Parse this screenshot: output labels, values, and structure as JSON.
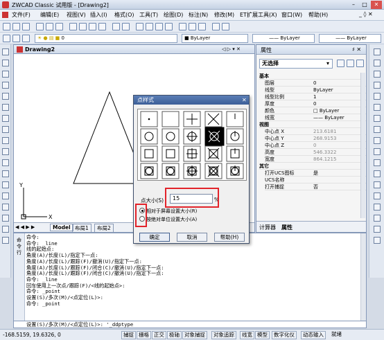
{
  "window": {
    "title": "ZWCAD Classic 试用版 - [Drawing2]",
    "min": "–",
    "max": "□",
    "close": "✕"
  },
  "menu": [
    "文件(F)",
    "编辑(E)",
    "视图(V)",
    "插入(I)",
    "格式(O)",
    "工具(T)",
    "绘图(D)",
    "标注(N)",
    "修改(M)",
    "ET扩展工具(X)",
    "窗口(W)",
    "帮助(H)"
  ],
  "mdi_controls": "_ ◊ ✕",
  "toolbar3": {
    "layer_value": "0",
    "color": "ByLayer",
    "linetype": "ByLayer",
    "lineweight": "ByLayer"
  },
  "drawing": {
    "tab_title": "Drawing2",
    "tab_controls": "◁ ▷ ▾ ✕",
    "layout_tabs": [
      "Model",
      "布局1",
      "布局2"
    ],
    "nav_arrows": "◀ ◀ ▶ ▶",
    "axis_y": "Y",
    "axis_x": "X"
  },
  "properties": {
    "title": "属性",
    "pin": "♯ ✕",
    "selection": "无选择",
    "sections": [
      {
        "name": "基本",
        "rows": [
          [
            "图层",
            "0"
          ],
          [
            "线型",
            "ByLayer"
          ],
          [
            "线型比例",
            "1"
          ],
          [
            "厚度",
            "0"
          ],
          [
            "颜色",
            "□ ByLayer"
          ],
          [
            "线宽",
            "—— ByLayer"
          ]
        ]
      },
      {
        "name": "视图",
        "rows": [
          [
            "中心点 X",
            "213.6181"
          ],
          [
            "中心点 Y",
            "268.9153"
          ],
          [
            "中心点 Z",
            "0"
          ],
          [
            "高度",
            "546.3322"
          ],
          [
            "宽度",
            "864.1215"
          ]
        ]
      },
      {
        "name": "其它",
        "rows": [
          [
            "打开UCS图标",
            "是"
          ],
          [
            "UCS名称",
            ""
          ],
          [
            "打开捕捉",
            "否"
          ]
        ]
      }
    ],
    "bottom_tabs": [
      "计算器",
      "属性"
    ]
  },
  "dialog": {
    "title": "点样式",
    "close": "✕",
    "size_label": "点大小(S)",
    "size_value": "15",
    "size_unit": "%",
    "radio_relative": "相对于屏幕设置大小(R)",
    "radio_absolute": "按绝对单位设置大小(A)",
    "ok": "确定",
    "cancel": "取消",
    "help": "帮助(H)"
  },
  "command": {
    "side_label": "命令行",
    "lines": [
      "命令:",
      "命令: _line",
      "线的起始点:",
      "角度(A)/长度(L)/指定下一点:",
      "角度(A)/长度(L)/跟踪(F)/撤消(U)/指定下一点:",
      "角度(A)/长度(L)/跟踪(F)/闭合(C)/撤消(U)/指定下一点:",
      "角度(A)/长度(L)/跟踪(F)/闭合(C)/撤消(U)/指定下一点:",
      "命令: _line",
      "回车使用上一次点/跟踪(F)/<线的起始点>:",
      "命令: _point",
      "设置(S)/多次(M)/<点定位(L)>:",
      "命令: _point"
    ],
    "input": "设置(S)/多次(M)/<点定位(L)>: '_ddptype"
  },
  "status": {
    "coords": "-168.5159, 19.6326, 0",
    "buttons": [
      "捕捉",
      "栅格",
      "正交",
      "极轴",
      "对象捕捉",
      "对象追踪",
      "线宽",
      "模型",
      "数字化仪",
      "动态输入",
      "就绪"
    ]
  }
}
